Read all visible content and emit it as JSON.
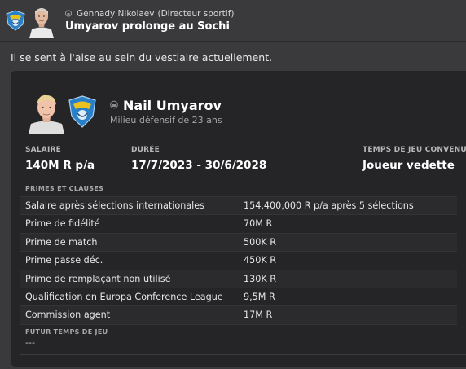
{
  "header": {
    "sender_name": "Gennady Nikolaev",
    "sender_role": "(Directeur sportif)",
    "title": "Umyarov prolonge au Sochi"
  },
  "intro": "Il se sent à l'aise au sein du vestiaire actuellement.",
  "player": {
    "name": "Nail Umyarov",
    "subtitle": "Milieu défensif de 23 ans"
  },
  "stats": {
    "salary_label": "SALAIRE",
    "salary_value": "140M R p/a",
    "duration_label": "DURÉE",
    "duration_value": "17/7/2023 - 30/6/2028",
    "playtime_label": "TEMPS DE JEU CONVENU",
    "playtime_value": "Joueur vedette"
  },
  "clauses": {
    "label": "PRIMES ET CLAUSES",
    "rows": [
      {
        "name": "Salaire après sélections internationales",
        "value": "154,400,000 R p/a après 5 sélections"
      },
      {
        "name": "Prime de fidélité",
        "value": "70M R"
      },
      {
        "name": "Prime de match",
        "value": "500K R"
      },
      {
        "name": "Prime passe déc.",
        "value": "450K R"
      },
      {
        "name": "Prime de remplaçant non utilisé",
        "value": "130K R"
      },
      {
        "name": "Qualification en Europa Conference League",
        "value": "9,5M R"
      },
      {
        "name": "Commission agent",
        "value": "17M R"
      }
    ]
  },
  "future": {
    "label": "FUTUR TEMPS DE JEU",
    "value": "---"
  },
  "icons": [
    "club-badge-icon",
    "lock-icon"
  ],
  "colors": {
    "background": "#3a3a3c",
    "card": "#252527",
    "badge_blue": "#2a7fc9",
    "badge_yellow": "#e8c020"
  }
}
